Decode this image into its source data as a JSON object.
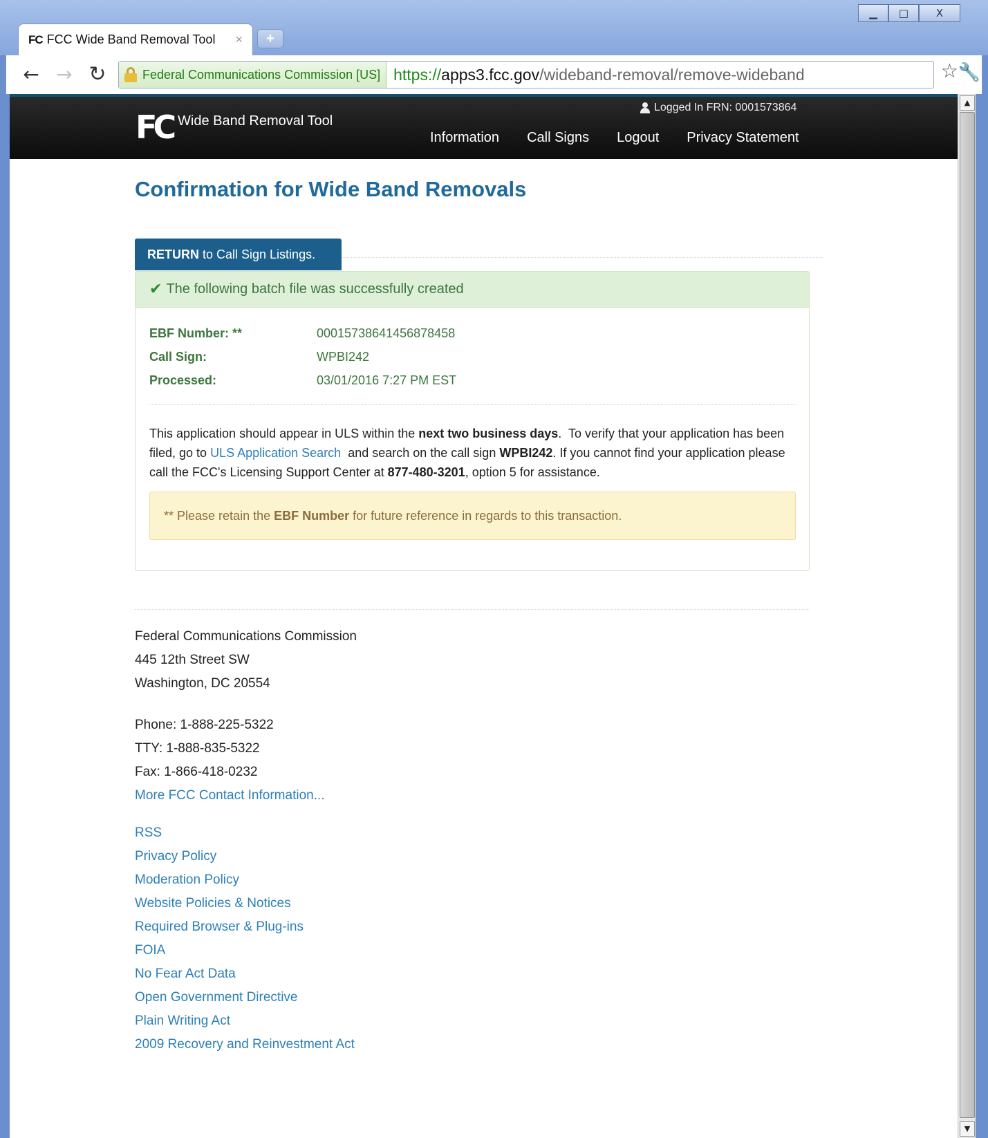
{
  "browser": {
    "tab_favicon": "FC",
    "tab_title": "FCC Wide Band Removal Tool",
    "tab_close": "×",
    "new_tab": "+",
    "ev_label": "Federal Communications Commission [US]",
    "url_scheme": "https://",
    "url_host": "apps3.fcc.gov",
    "url_path": "/wideband-removal/remove-wideband",
    "window_buttons": {
      "minimize": "▁",
      "maximize": "□",
      "close": "X"
    },
    "icons": [
      "back-arrow-icon",
      "forward-arrow-icon",
      "reload-icon",
      "lock-icon",
      "star-icon",
      "wrench-icon"
    ]
  },
  "header": {
    "logo_text": "FC",
    "site_title": "Wide Band Removal Tool",
    "login_text": "Logged In FRN: 0001573864",
    "nav": [
      "Information",
      "Call Signs",
      "Logout",
      "Privacy Statement"
    ]
  },
  "main": {
    "page_title": "Confirmation for Wide Band Removals",
    "return_bold": "RETURN",
    "return_rest": " to Call Sign Listings.",
    "success_message": "The following batch file was successfully created",
    "details": [
      {
        "label": "EBF Number: **",
        "value": "00015738641456878458"
      },
      {
        "label": "Call Sign:",
        "value": "WPBI242"
      },
      {
        "label": "Processed:",
        "value": "03/01/2016 7:27 PM EST"
      }
    ],
    "para": {
      "t1": "This application should appear in ULS within the ",
      "b1": "next two business days",
      "t2": ".  To verify that your application has been filed, go to ",
      "link": "ULS Application Search",
      "t3": "  and search on the call sign ",
      "b2": "WPBI242",
      "t4": ". If you cannot find your application please call the FCC's Licensing Support Center at ",
      "b3": "877-480-3201",
      "t5": ", option 5 for assistance."
    },
    "notice": {
      "t1": "** Please retain the ",
      "b1": "EBF Number",
      "t2": " for future reference in regards to this transaction."
    }
  },
  "footer": {
    "address": [
      "Federal Communications Commission",
      "445 12th Street SW",
      "Washington, DC 20554"
    ],
    "contacts": [
      "Phone: 1-888-225-5322",
      "TTY: 1-888-835-5322",
      "Fax: 1-866-418-0232"
    ],
    "more_contact": "More FCC Contact Information...",
    "links": [
      "RSS",
      "Privacy Policy",
      "Moderation Policy",
      "Website Policies & Notices",
      "Required Browser & Plug-ins",
      "FOIA",
      "No Fear Act Data",
      "Open Government Directive",
      "Plain Writing Act",
      "2009 Recovery and Reinvestment Act"
    ]
  },
  "colors": {
    "title_blue": "#1f6a9a",
    "button_blue": "#1c5f8c",
    "link_blue": "#2c7fb8",
    "success_green": "#3c763d",
    "success_bg": "#dff0d8",
    "notice_bg": "#fcf3cf"
  }
}
